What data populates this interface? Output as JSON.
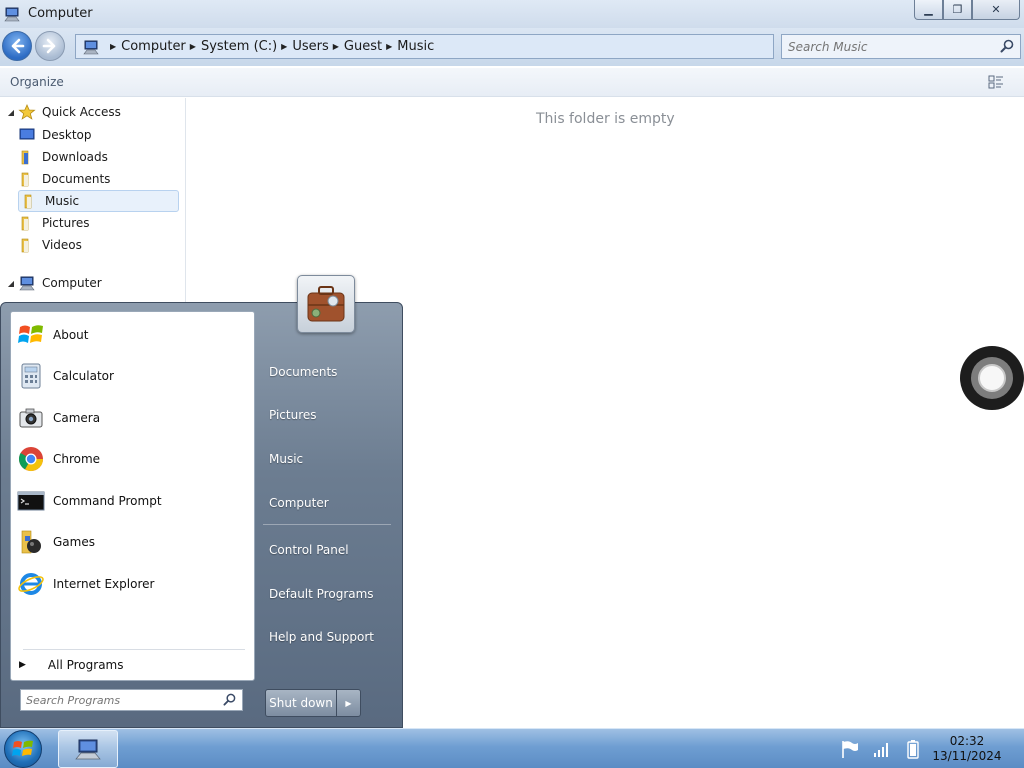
{
  "window": {
    "title": "Computer",
    "icon": "computer-icon",
    "controls": {
      "minimize": "minimize-icon",
      "maximize": "maximize-icon",
      "close": "close-icon"
    }
  },
  "address": {
    "breadcrumbs": [
      "Computer",
      "System (C:)",
      "Users",
      "Guest",
      "Music"
    ]
  },
  "search": {
    "placeholder": "Search Music"
  },
  "toolbar": {
    "organize_label": "Organize"
  },
  "navpane": {
    "quick_access": {
      "label": "Quick Access",
      "items": [
        {
          "label": "Desktop",
          "icon": "desktop-icon"
        },
        {
          "label": "Downloads",
          "icon": "folder-icon"
        },
        {
          "label": "Documents",
          "icon": "folder-icon"
        },
        {
          "label": "Music",
          "icon": "folder-icon",
          "selected": true
        },
        {
          "label": "Pictures",
          "icon": "folder-icon"
        },
        {
          "label": "Videos",
          "icon": "folder-icon"
        }
      ]
    },
    "computer": {
      "label": "Computer"
    }
  },
  "content": {
    "empty_message": "This folder is empty"
  },
  "start_menu": {
    "programs": [
      {
        "label": "About",
        "icon": "windows-logo-icon"
      },
      {
        "label": "Calculator",
        "icon": "calculator-icon"
      },
      {
        "label": "Camera",
        "icon": "camera-icon"
      },
      {
        "label": "Chrome",
        "icon": "chrome-icon"
      },
      {
        "label": "Command Prompt",
        "icon": "command-prompt-icon"
      },
      {
        "label": "Games",
        "icon": "games-icon"
      },
      {
        "label": "Internet Explorer",
        "icon": "internet-explorer-icon"
      }
    ],
    "all_programs_label": "All Programs",
    "search_placeholder": "Search Programs",
    "places": [
      "Documents",
      "Pictures",
      "Music",
      "Computer",
      "Control Panel",
      "Default Programs",
      "Help and Support"
    ],
    "shutdown_label": "Shut down"
  },
  "taskbar": {
    "clock_time": "02:32",
    "clock_date": "13/11/2024"
  },
  "colors": {
    "taskbar": "#6f9ed2",
    "start_menu_right": "#6c7d91",
    "selection": "#e8f1fb"
  }
}
